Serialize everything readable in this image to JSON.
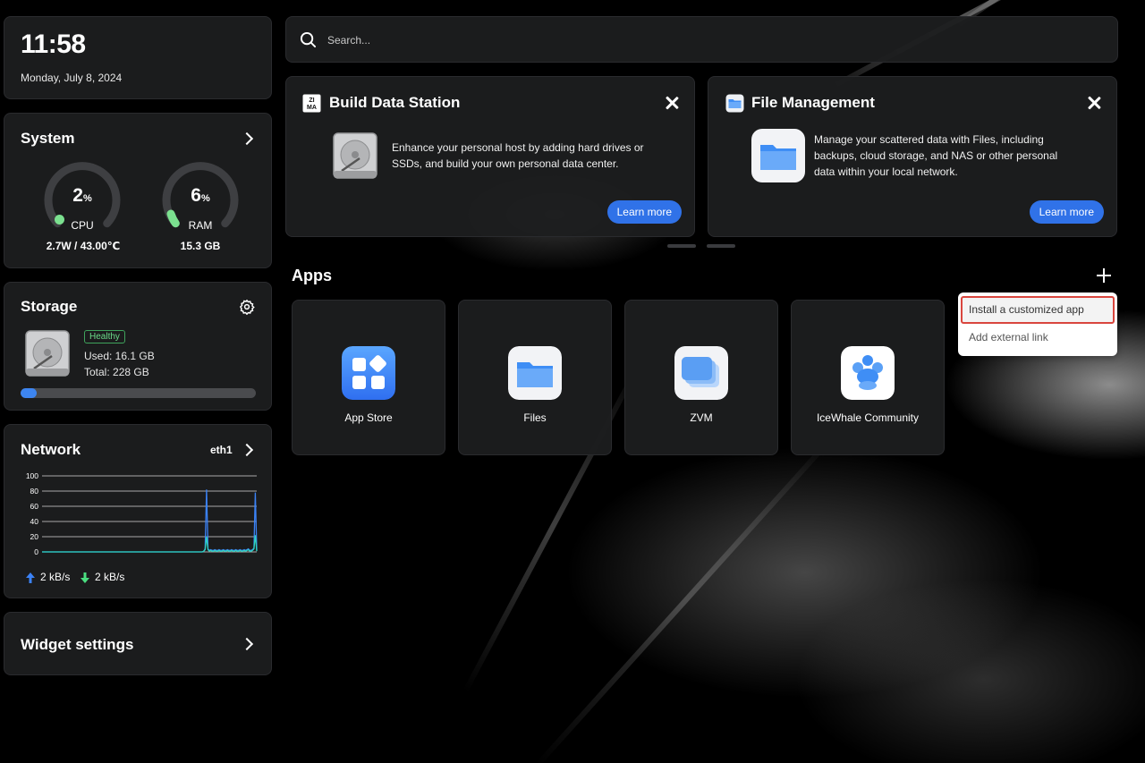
{
  "clock": {
    "time": "11:58",
    "date": "Monday, July 8, 2024"
  },
  "system": {
    "title": "System",
    "cpu": {
      "value": "2",
      "unit": "%",
      "label": "CPU",
      "sub": "2.7W / 43.00℃",
      "percent": 2
    },
    "ram": {
      "value": "6",
      "unit": "%",
      "label": "RAM",
      "sub": "15.3 GB",
      "percent": 6
    }
  },
  "storage": {
    "title": "Storage",
    "status": "Healthy",
    "used": "Used: 16.1 GB",
    "total": "Total: 228 GB",
    "used_fraction": 0.07
  },
  "network": {
    "title": "Network",
    "interface": "eth1",
    "upload": "2 kB/s",
    "download": "2 kB/s",
    "chart_data": {
      "type": "line",
      "y_ticks": [
        "100",
        "80",
        "60",
        "40",
        "20",
        "0"
      ],
      "ylim": [
        0,
        100
      ],
      "series": [
        {
          "values": [
            0,
            0,
            0,
            0,
            0,
            0,
            0,
            0,
            0,
            0,
            0,
            0,
            0,
            0,
            0,
            0,
            0,
            0,
            0,
            0,
            0,
            0,
            0,
            0,
            0,
            0,
            0,
            0,
            0,
            0,
            0,
            0,
            0,
            0,
            0,
            0,
            0,
            0,
            0,
            0,
            0,
            0,
            0,
            0,
            0,
            0,
            0,
            0,
            0,
            0,
            0,
            0,
            0,
            0,
            0,
            0,
            0,
            0,
            0,
            0,
            0,
            0,
            0,
            0,
            0,
            0,
            0,
            0,
            0,
            0,
            0,
            0,
            0,
            0,
            0,
            0,
            0,
            0,
            0,
            0,
            0,
            0,
            0,
            0,
            0,
            0,
            0,
            0,
            0,
            0,
            0,
            0,
            0,
            0,
            0,
            0,
            0,
            0,
            0,
            0,
            0,
            0,
            0,
            0,
            0,
            0,
            0,
            0,
            0,
            0,
            0,
            0,
            0,
            0,
            0,
            0,
            1,
            4,
            82,
            4,
            2,
            3,
            2,
            2,
            3,
            2,
            2,
            3,
            2,
            2,
            3,
            2,
            2,
            3,
            2,
            2,
            3,
            2,
            2,
            3,
            2,
            2,
            3,
            2,
            2,
            3,
            2,
            3,
            4,
            2,
            2,
            3,
            5,
            78,
            2
          ]
        },
        {
          "values": [
            0,
            0,
            0,
            0,
            0,
            0,
            0,
            0,
            0,
            0,
            0,
            0,
            0,
            0,
            0,
            0,
            0,
            0,
            0,
            0,
            0,
            0,
            0,
            0,
            0,
            0,
            0,
            0,
            0,
            0,
            0,
            0,
            0,
            0,
            0,
            0,
            0,
            0,
            0,
            0,
            0,
            0,
            0,
            0,
            0,
            0,
            0,
            0,
            0,
            0,
            0,
            0,
            0,
            0,
            0,
            0,
            0,
            0,
            0,
            0,
            0,
            0,
            0,
            0,
            0,
            0,
            0,
            0,
            0,
            0,
            0,
            0,
            0,
            0,
            0,
            0,
            0,
            0,
            0,
            0,
            0,
            0,
            0,
            0,
            0,
            0,
            0,
            0,
            0,
            0,
            0,
            0,
            0,
            0,
            0,
            0,
            0,
            0,
            0,
            0,
            0,
            0,
            0,
            0,
            0,
            0,
            0,
            0,
            0,
            0,
            0,
            0,
            0,
            0,
            0,
            0,
            1,
            3,
            20,
            3,
            1,
            2,
            1,
            1,
            2,
            1,
            1,
            2,
            1,
            1,
            2,
            1,
            1,
            2,
            1,
            1,
            2,
            1,
            1,
            2,
            1,
            1,
            2,
            1,
            1,
            2,
            1,
            2,
            3,
            1,
            1,
            2,
            4,
            22,
            1
          ]
        }
      ],
      "colors": [
        "#3b82f6",
        "#2dd4bf"
      ]
    }
  },
  "widget_settings": {
    "title": "Widget settings"
  },
  "search": {
    "placeholder": "Search..."
  },
  "cards": [
    {
      "title": "Build Data Station",
      "desc_lines": [
        "Enhance your personal host by adding hard drives or",
        "SSDs, and build your own personal data center."
      ],
      "button": "Learn more"
    },
    {
      "title": "File Management",
      "desc_lines": [
        "Manage your scattered data with Files, including",
        "backups, cloud storage, and NAS or other personal",
        "data within your local network."
      ],
      "button": "Learn more"
    }
  ],
  "apps": {
    "title": "Apps",
    "items": [
      {
        "label": "App Store",
        "icon": "app-store-icon"
      },
      {
        "label": "Files",
        "icon": "folder-icon"
      },
      {
        "label": "ZVM",
        "icon": "zvm-icon"
      },
      {
        "label": "IceWhale Community",
        "icon": "community-icon"
      }
    ],
    "menu": [
      "Install a customized app",
      "Add external link"
    ]
  },
  "colors": {
    "accent": "#3072e8",
    "gauge_green": "#7be08f",
    "healthy": "#6bdc8a"
  }
}
